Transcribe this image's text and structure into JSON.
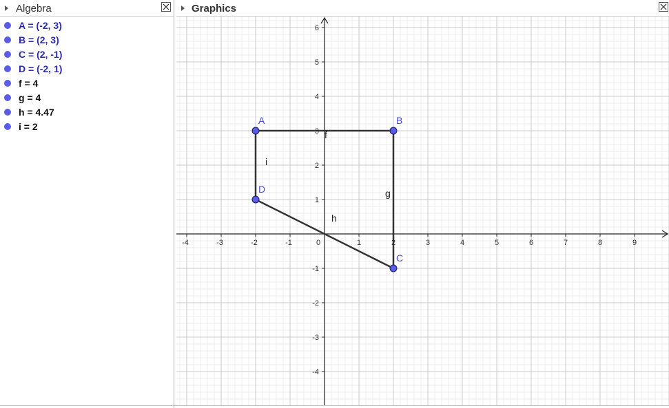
{
  "algebra": {
    "title": "Algebra",
    "items": [
      {
        "text": "A = (-2, 3)",
        "kind": "point"
      },
      {
        "text": "B = (2, 3)",
        "kind": "point"
      },
      {
        "text": "C = (2, -1)",
        "kind": "point"
      },
      {
        "text": "D = (-2, 1)",
        "kind": "point"
      },
      {
        "text": "f = 4",
        "kind": "number"
      },
      {
        "text": "g = 4",
        "kind": "number"
      },
      {
        "text": "h = 4.47",
        "kind": "number"
      },
      {
        "text": "i = 2",
        "kind": "number"
      }
    ]
  },
  "graphics": {
    "title": "Graphics",
    "x_ticks": [
      -4,
      -3,
      -2,
      -1,
      0,
      1,
      2,
      3,
      4,
      5,
      6,
      7,
      8,
      9
    ],
    "y_ticks": [
      -4,
      -3,
      -2,
      -1,
      1,
      2,
      3,
      4,
      5,
      6
    ],
    "points": [
      {
        "name": "A",
        "x": -2,
        "y": 3
      },
      {
        "name": "B",
        "x": 2,
        "y": 3
      },
      {
        "name": "C",
        "x": 2,
        "y": -1
      },
      {
        "name": "D",
        "x": -2,
        "y": 1
      }
    ],
    "segments": [
      {
        "name": "f",
        "from": "A",
        "to": "B"
      },
      {
        "name": "g",
        "from": "B",
        "to": "C"
      },
      {
        "name": "h",
        "from": "C",
        "to": "D"
      },
      {
        "name": "i",
        "from": "D",
        "to": "A"
      }
    ]
  },
  "colors": {
    "point_fill": "#5b5ce6",
    "point_label": "#4a4ad6",
    "segment": "#333333",
    "grid_major": "#c8c8c8",
    "grid_minor": "#ececec",
    "axis": "#222222"
  }
}
